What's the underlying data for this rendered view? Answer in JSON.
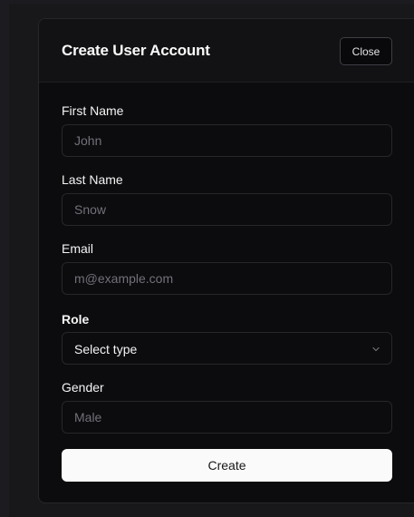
{
  "dialog": {
    "title": "Create User Account",
    "close_label": "Close"
  },
  "form": {
    "first_name": {
      "label": "First Name",
      "placeholder": "John"
    },
    "last_name": {
      "label": "Last Name",
      "placeholder": "Snow"
    },
    "email": {
      "label": "Email",
      "placeholder": "m@example.com"
    },
    "role": {
      "label": "Role",
      "selected": "Select type",
      "icon": "chevron-down-icon"
    },
    "gender": {
      "label": "Gender",
      "placeholder": "Male"
    },
    "submit_label": "Create"
  },
  "colors": {
    "background": "#18181b",
    "dialog_bg": "#0c0c0e",
    "border": "#27272a",
    "text": "#f4f4f5",
    "placeholder": "#71717a",
    "primary_button": "#fafafa"
  }
}
